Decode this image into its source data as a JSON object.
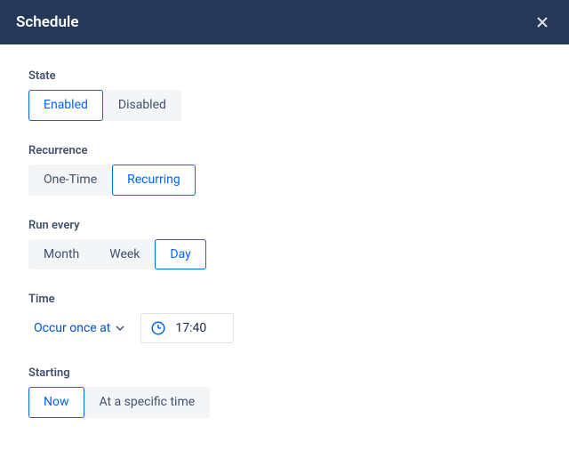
{
  "header": {
    "title": "Schedule"
  },
  "state": {
    "label": "State",
    "options": {
      "enabled": "Enabled",
      "disabled": "Disabled"
    },
    "selected": "enabled"
  },
  "recurrence": {
    "label": "Recurrence",
    "options": {
      "onetime": "One-Time",
      "recurring": "Recurring"
    },
    "selected": "recurring"
  },
  "run_every": {
    "label": "Run every",
    "options": {
      "month": "Month",
      "week": "Week",
      "day": "Day"
    },
    "selected": "day"
  },
  "time": {
    "label": "Time",
    "mode_label": "Occur once at",
    "value": "17:40"
  },
  "starting": {
    "label": "Starting",
    "options": {
      "now": "Now",
      "specific": "At a specific time"
    },
    "selected": "now"
  }
}
